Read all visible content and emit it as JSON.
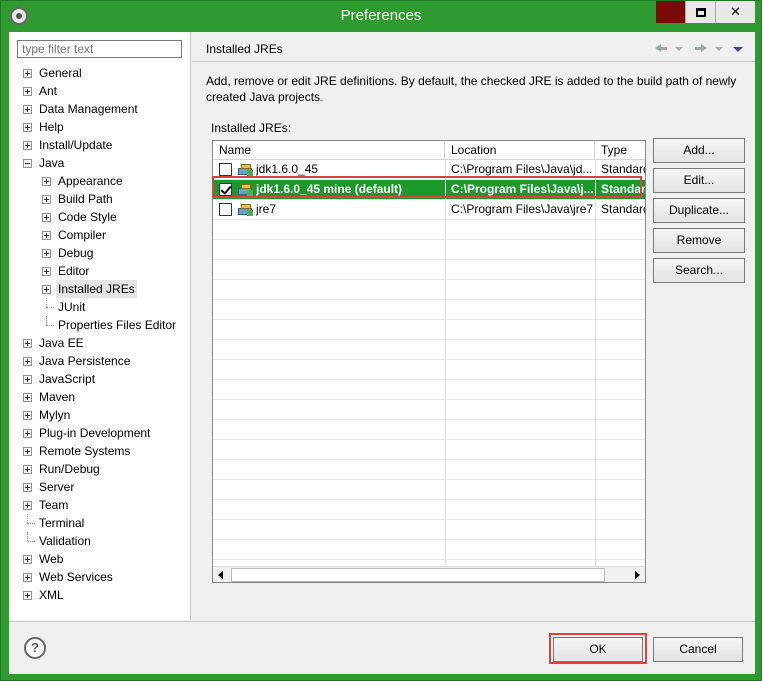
{
  "window": {
    "title": "Preferences"
  },
  "filter": {
    "placeholder": "type filter text"
  },
  "tree": [
    {
      "label": "General",
      "level": 0,
      "expandable": true,
      "expanded": false
    },
    {
      "label": "Ant",
      "level": 0,
      "expandable": true,
      "expanded": false
    },
    {
      "label": "Data Management",
      "level": 0,
      "expandable": true,
      "expanded": false
    },
    {
      "label": "Help",
      "level": 0,
      "expandable": true,
      "expanded": false
    },
    {
      "label": "Install/Update",
      "level": 0,
      "expandable": true,
      "expanded": false
    },
    {
      "label": "Java",
      "level": 0,
      "expandable": true,
      "expanded": true
    },
    {
      "label": "Appearance",
      "level": 1,
      "expandable": true,
      "expanded": false
    },
    {
      "label": "Build Path",
      "level": 1,
      "expandable": true,
      "expanded": false
    },
    {
      "label": "Code Style",
      "level": 1,
      "expandable": true,
      "expanded": false
    },
    {
      "label": "Compiler",
      "level": 1,
      "expandable": true,
      "expanded": false
    },
    {
      "label": "Debug",
      "level": 1,
      "expandable": true,
      "expanded": false
    },
    {
      "label": "Editor",
      "level": 1,
      "expandable": true,
      "expanded": false
    },
    {
      "label": "Installed JREs",
      "level": 1,
      "expandable": true,
      "expanded": false,
      "selected": true
    },
    {
      "label": "JUnit",
      "level": 1,
      "expandable": false
    },
    {
      "label": "Properties Files Editor",
      "level": 1,
      "expandable": false
    },
    {
      "label": "Java EE",
      "level": 0,
      "expandable": true,
      "expanded": false
    },
    {
      "label": "Java Persistence",
      "level": 0,
      "expandable": true,
      "expanded": false
    },
    {
      "label": "JavaScript",
      "level": 0,
      "expandable": true,
      "expanded": false
    },
    {
      "label": "Maven",
      "level": 0,
      "expandable": true,
      "expanded": false
    },
    {
      "label": "Mylyn",
      "level": 0,
      "expandable": true,
      "expanded": false
    },
    {
      "label": "Plug-in Development",
      "level": 0,
      "expandable": true,
      "expanded": false
    },
    {
      "label": "Remote Systems",
      "level": 0,
      "expandable": true,
      "expanded": false
    },
    {
      "label": "Run/Debug",
      "level": 0,
      "expandable": true,
      "expanded": false
    },
    {
      "label": "Server",
      "level": 0,
      "expandable": true,
      "expanded": false
    },
    {
      "label": "Team",
      "level": 0,
      "expandable": true,
      "expanded": false
    },
    {
      "label": "Terminal",
      "level": 0,
      "expandable": false
    },
    {
      "label": "Validation",
      "level": 0,
      "expandable": false
    },
    {
      "label": "Web",
      "level": 0,
      "expandable": true,
      "expanded": false
    },
    {
      "label": "Web Services",
      "level": 0,
      "expandable": true,
      "expanded": false
    },
    {
      "label": "XML",
      "level": 0,
      "expandable": true,
      "expanded": false
    }
  ],
  "page": {
    "title": "Installed JREs",
    "description": "Add, remove or edit JRE definitions. By default, the checked JRE is added to the build path of newly created Java projects.",
    "section_label": "Installed JREs:",
    "columns": [
      "Name",
      "Location",
      "Type"
    ],
    "rows": [
      {
        "checked": false,
        "name": "jdk1.6.0_45",
        "location": "C:\\Program Files\\Java\\jd...",
        "type": "Standard",
        "selected": false
      },
      {
        "checked": true,
        "name": "jdk1.6.0_45 mine (default)",
        "location": "C:\\Program Files\\Java\\j...",
        "type": "Standard",
        "selected": true
      },
      {
        "checked": false,
        "name": "jre7",
        "location": "C:\\Program Files\\Java\\jre7",
        "type": "Standard",
        "selected": false
      }
    ],
    "buttons": {
      "add": "Add...",
      "edit": "Edit...",
      "duplicate": "Duplicate...",
      "remove": "Remove",
      "search": "Search..."
    }
  },
  "footer": {
    "ok": "OK",
    "cancel": "Cancel",
    "help_icon": "?"
  },
  "colors": {
    "accent": "#2f9a2f",
    "selection": "#1a9a2a",
    "highlight": "#e04040"
  }
}
